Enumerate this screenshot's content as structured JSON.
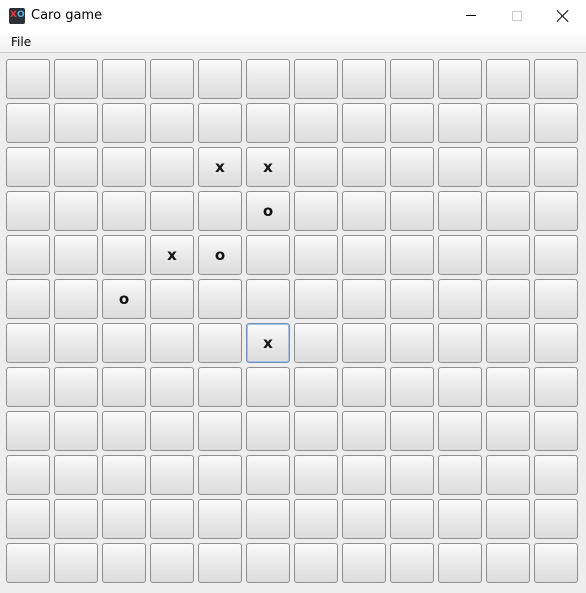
{
  "window": {
    "title": "Caro game",
    "icon": "caro-xo-icon",
    "controls": [
      "minimize-icon",
      "maximize-icon",
      "close-icon"
    ]
  },
  "menu": {
    "items": [
      {
        "label": "File"
      }
    ]
  },
  "board": {
    "rows": 12,
    "cols": 12,
    "cells": [
      [
        "",
        "",
        "",
        "",
        "",
        "",
        "",
        "",
        "",
        "",
        "",
        ""
      ],
      [
        "",
        "",
        "",
        "",
        "",
        "",
        "",
        "",
        "",
        "",
        "",
        ""
      ],
      [
        "",
        "",
        "",
        "",
        "x",
        "x",
        "",
        "",
        "",
        "",
        "",
        ""
      ],
      [
        "",
        "",
        "",
        "",
        "",
        "o",
        "",
        "",
        "",
        "",
        "",
        ""
      ],
      [
        "",
        "",
        "",
        "x",
        "o",
        "",
        "",
        "",
        "",
        "",
        "",
        ""
      ],
      [
        "",
        "",
        "o",
        "",
        "",
        "",
        "",
        "",
        "",
        "",
        "",
        ""
      ],
      [
        "",
        "",
        "",
        "",
        "",
        "x",
        "",
        "",
        "",
        "",
        "",
        ""
      ],
      [
        "",
        "",
        "",
        "",
        "",
        "",
        "",
        "",
        "",
        "",
        "",
        ""
      ],
      [
        "",
        "",
        "",
        "",
        "",
        "",
        "",
        "",
        "",
        "",
        "",
        ""
      ],
      [
        "",
        "",
        "",
        "",
        "",
        "",
        "",
        "",
        "",
        "",
        "",
        ""
      ],
      [
        "",
        "",
        "",
        "",
        "",
        "",
        "",
        "",
        "",
        "",
        "",
        ""
      ],
      [
        "",
        "",
        "",
        "",
        "",
        "",
        "",
        "",
        "",
        "",
        "",
        ""
      ]
    ],
    "focused": {
      "row": 6,
      "col": 5
    }
  }
}
